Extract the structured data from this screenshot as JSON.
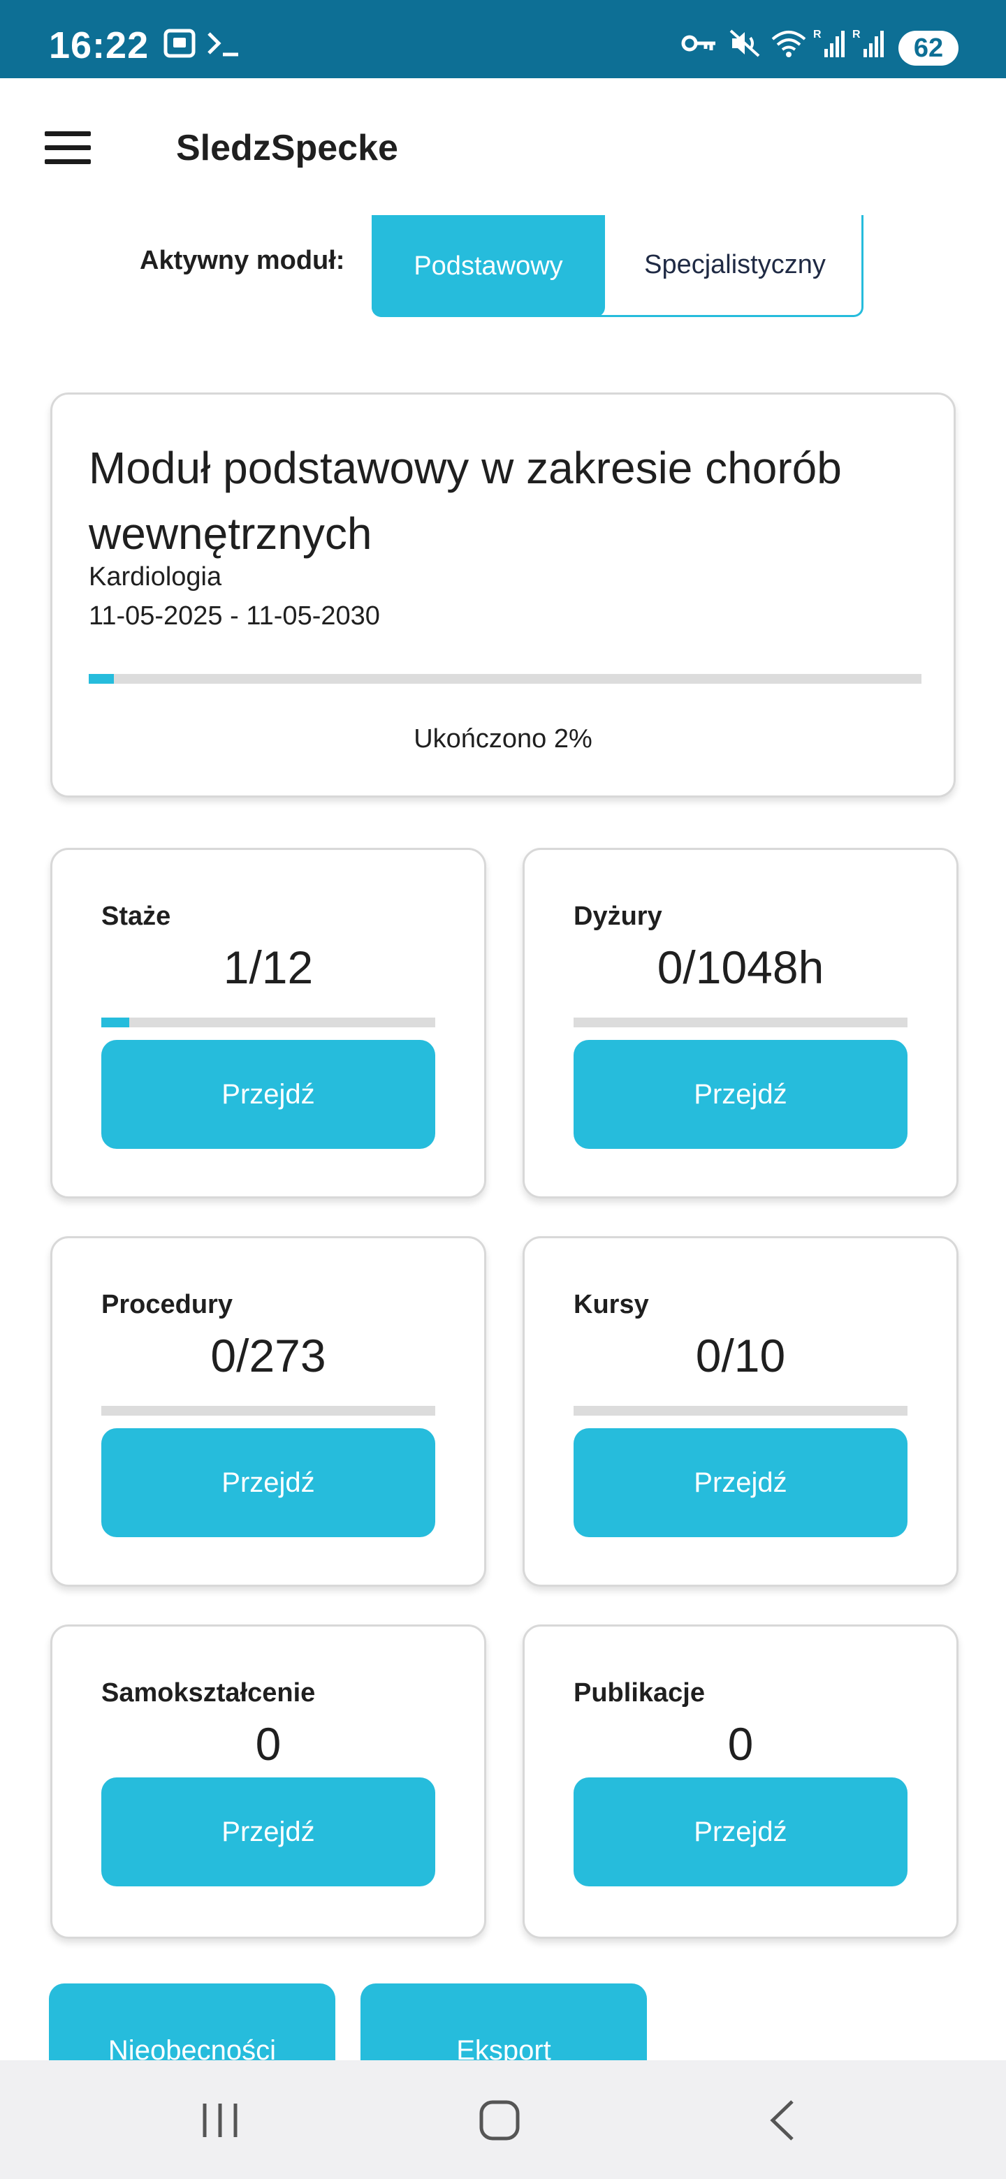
{
  "status_bar": {
    "time": "16:22",
    "icons": [
      "screenshot-icon",
      "terminal-icon",
      "vpn-key-icon",
      "mute-icon",
      "wifi-icon",
      "signal-r-icon",
      "signal-r-icon"
    ],
    "battery": "62"
  },
  "app_bar": {
    "title": "SledzSpecke",
    "menu_icon": "menu-icon"
  },
  "module_switch": {
    "label": "Aktywny moduł:",
    "options": [
      "Podstawowy",
      "Specjalistyczny"
    ],
    "selected": "Podstawowy"
  },
  "module_card": {
    "title": "Moduł podstawowy w zakresie chorób wewnętrznych",
    "specialization": "Kardiologia",
    "dates": "11-05-2025 - 11-05-2030",
    "progress": 0.02,
    "status": "Ukończono 2%"
  },
  "tiles": [
    {
      "label": "Staże",
      "value": "1/12",
      "progress": 0.0833,
      "button": "Przejdź"
    },
    {
      "label": "Dyżury",
      "value": "0/1048h",
      "progress": 0,
      "button": "Przejdź"
    },
    {
      "label": "Procedury",
      "value": "0/273",
      "progress": 0,
      "button": "Przejdź"
    },
    {
      "label": "Kursy",
      "value": "0/10",
      "progress": 0,
      "button": "Przejdź"
    },
    {
      "label": "Samokształcenie",
      "value": "0",
      "button": "Przejdź"
    },
    {
      "label": "Publikacje",
      "value": "0",
      "button": "Przejdź"
    }
  ],
  "bottom_buttons": [
    "Nieobecności",
    "Eksport"
  ],
  "nav_bar": {
    "recents_icon": "recents-icon",
    "home_icon": "home-icon",
    "back_icon": "back-icon"
  },
  "colors": {
    "status_bar": "#0d6f95",
    "accent": "#26bcdc",
    "track": "#dcdcdc"
  }
}
